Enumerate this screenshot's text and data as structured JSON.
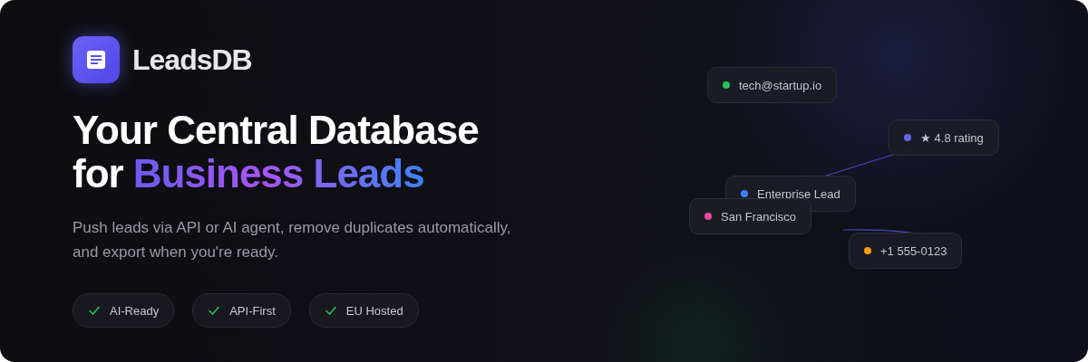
{
  "brand": {
    "name": "LeadsDB"
  },
  "headline": {
    "line_1": "Your Central Database",
    "line_2_prefix": "for",
    "line_2_highlight": "Business Leads"
  },
  "description": "Push leads via API or AI agent, remove duplicates automatically, and export when you're ready.",
  "features": [
    {
      "label": "AI-Ready"
    },
    {
      "label": "API-First"
    },
    {
      "label": "EU Hosted"
    }
  ],
  "lead_chips": [
    {
      "label": "tech@startup.io",
      "color": "#22c55e"
    },
    {
      "label": "★ 4.8 rating",
      "color": "#6366f1"
    },
    {
      "label": "Enterprise Lead",
      "color": "#3b82f6"
    },
    {
      "label": "San Francisco",
      "color": "#ec4899"
    },
    {
      "label": "+1 555-0123",
      "color": "#f59e0b"
    }
  ]
}
